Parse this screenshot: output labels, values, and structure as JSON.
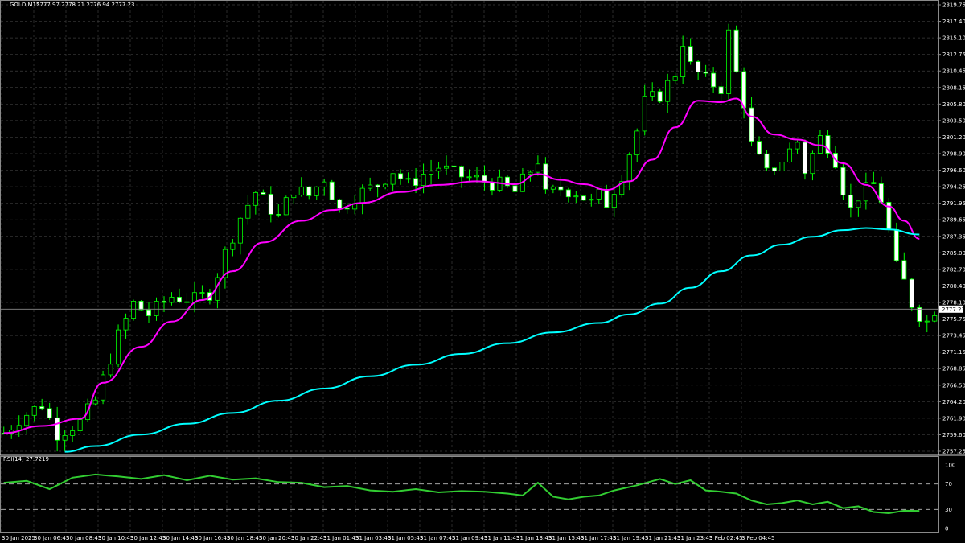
{
  "header": {
    "symbol": "GOLD,M15",
    "ohlc": "2777.97 2778.21 2776.94 2777.23"
  },
  "rsi": {
    "label": "RSI(14) 27.7219",
    "levels": [
      70,
      30
    ],
    "scale_labels": [
      "100",
      "70",
      "30",
      "0"
    ]
  },
  "colors": {
    "background": "#000000",
    "grid": "#3c3c3c",
    "candle_up": "#000000",
    "candle_down": "#ffffff",
    "candle_border": "#00ff00",
    "ma_fast": "#ff00ff",
    "ma_slow": "#00ffff",
    "rsi_line": "#32cd32",
    "price_line": "#8a8a8a"
  },
  "chart_data": {
    "type": "candlestick",
    "symbol": "GOLD",
    "timeframe": "M15",
    "ylim": [
      2757.25,
      2819.75
    ],
    "y_ticks": [
      "2819.75",
      "2817.40",
      "2815.10",
      "2812.75",
      "2810.45",
      "2808.15",
      "2805.80",
      "2803.50",
      "2801.20",
      "2798.90",
      "2796.60",
      "2794.25",
      "2791.95",
      "2789.65",
      "2787.35",
      "2785.00",
      "2782.70",
      "2780.40",
      "2778.10",
      "2775.75",
      "2773.45",
      "2771.15",
      "2768.85",
      "2766.50",
      "2764.20",
      "2761.90",
      "2759.60",
      "2757.25"
    ],
    "current_price": "2777.23",
    "x_ticks": [
      "30 Jan 2025",
      "30 Jan 06:45",
      "30 Jan 08:45",
      "30 Jan 10:45",
      "30 Jan 12:45",
      "30 Jan 14:45",
      "30 Jan 16:45",
      "30 Jan 18:45",
      "30 Jan 20:45",
      "30 Jan 22:45",
      "31 Jan 01:45",
      "31 Jan 03:45",
      "31 Jan 05:45",
      "31 Jan 07:45",
      "31 Jan 09:45",
      "31 Jan 11:45",
      "31 Jan 13:45",
      "31 Jan 15:45",
      "31 Jan 17:45",
      "31 Jan 19:45",
      "31 Jan 21:45",
      "31 Jan 23:45",
      "3 Feb 02:45",
      "3 Feb 04:45"
    ],
    "close_path": [
      [
        0,
        2760.0
      ],
      [
        2,
        2762.0
      ],
      [
        5,
        2764.0
      ],
      [
        7,
        2760.0
      ],
      [
        10,
        2761.5
      ],
      [
        12,
        2764.5
      ],
      [
        15,
        2773.5
      ],
      [
        17,
        2778.0
      ],
      [
        19,
        2776.5
      ],
      [
        22,
        2779.0
      ],
      [
        25,
        2778.5
      ],
      [
        27,
        2779.5
      ],
      [
        29,
        2785.0
      ],
      [
        31,
        2790.0
      ],
      [
        33,
        2793.5
      ],
      [
        36,
        2790.0
      ],
      [
        38,
        2794.0
      ],
      [
        40,
        2793.0
      ],
      [
        42,
        2795.5
      ],
      [
        44,
        2791.0
      ],
      [
        46,
        2793.0
      ],
      [
        49,
        2794.5
      ],
      [
        51,
        2796.5
      ],
      [
        53,
        2794.5
      ],
      [
        55,
        2796.0
      ],
      [
        57,
        2797.0
      ],
      [
        59,
        2796.0
      ],
      [
        61,
        2795.5
      ],
      [
        63,
        2795.0
      ],
      [
        65,
        2794.5
      ],
      [
        67,
        2793.5
      ],
      [
        68,
        2795.0
      ],
      [
        70,
        2798.0
      ],
      [
        71,
        2793.0
      ],
      [
        73,
        2794.0
      ],
      [
        75,
        2793.5
      ],
      [
        77,
        2792.0
      ],
      [
        78,
        2793.0
      ],
      [
        79,
        2792.0
      ],
      [
        81,
        2796.0
      ],
      [
        83,
        2802.0
      ],
      [
        84,
        2806.0
      ],
      [
        86,
        2807.0
      ],
      [
        88,
        2810.0
      ],
      [
        89,
        2814.5
      ],
      [
        90,
        2811.0
      ],
      [
        92,
        2809.0
      ],
      [
        94,
        2808.0
      ],
      [
        95,
        2815.5
      ],
      [
        96,
        2810.0
      ],
      [
        97,
        2806.0
      ],
      [
        98,
        2800.0
      ],
      [
        100,
        2796.0
      ],
      [
        102,
        2798.0
      ],
      [
        104,
        2800.5
      ],
      [
        105,
        2796.5
      ],
      [
        107,
        2801.0
      ],
      [
        108,
        2800.0
      ],
      [
        109,
        2798.0
      ],
      [
        110,
        2794.0
      ],
      [
        111,
        2791.0
      ],
      [
        112,
        2793.0
      ],
      [
        114,
        2794.5
      ],
      [
        115,
        2792.5
      ],
      [
        116,
        2788.0
      ],
      [
        117,
        2783.0
      ],
      [
        118,
        2781.0
      ],
      [
        119,
        2778.0
      ],
      [
        120,
        2776.5
      ],
      [
        121,
        2775.5
      ],
      [
        122,
        2777.23
      ]
    ],
    "series": [
      {
        "name": "",
        "color": "#ff00ff",
        "points": [
          [
            0,
            2760.0
          ],
          [
            5,
            2761.0
          ],
          [
            10,
            2762.0
          ],
          [
            13,
            2767.0
          ],
          [
            18,
            2772.0
          ],
          [
            22,
            2775.5
          ],
          [
            26,
            2778.5
          ],
          [
            30,
            2782.5
          ],
          [
            34,
            2786.5
          ],
          [
            39,
            2789.5
          ],
          [
            43,
            2791.0
          ],
          [
            47,
            2792.0
          ],
          [
            52,
            2793.5
          ],
          [
            57,
            2794.5
          ],
          [
            62,
            2795.0
          ],
          [
            67,
            2794.6
          ],
          [
            70,
            2796.0
          ],
          [
            73,
            2795.2
          ],
          [
            76,
            2794.6
          ],
          [
            79,
            2793.8
          ],
          [
            82,
            2795.0
          ],
          [
            85,
            2798.0
          ],
          [
            88,
            2802.5
          ],
          [
            91,
            2806.2
          ],
          [
            94,
            2806.0
          ],
          [
            96,
            2806.5
          ],
          [
            98,
            2804.0
          ],
          [
            101,
            2801.5
          ],
          [
            104,
            2800.8
          ],
          [
            107,
            2800.0
          ],
          [
            110,
            2797.5
          ],
          [
            113,
            2794.5
          ],
          [
            116,
            2791.5
          ],
          [
            118,
            2789.5
          ],
          [
            120,
            2787.0
          ]
        ]
      },
      {
        "name": "",
        "color": "#00ffff",
        "points": [
          [
            8,
            2757.4
          ],
          [
            12,
            2758.2
          ],
          [
            18,
            2759.8
          ],
          [
            24,
            2761.3
          ],
          [
            30,
            2762.8
          ],
          [
            36,
            2764.5
          ],
          [
            42,
            2766.2
          ],
          [
            48,
            2767.9
          ],
          [
            54,
            2769.5
          ],
          [
            60,
            2771.0
          ],
          [
            66,
            2772.5
          ],
          [
            72,
            2774.0
          ],
          [
            78,
            2775.3
          ],
          [
            82,
            2776.5
          ],
          [
            86,
            2778.0
          ],
          [
            90,
            2780.2
          ],
          [
            94,
            2782.5
          ],
          [
            98,
            2784.7
          ],
          [
            102,
            2786.2
          ],
          [
            106,
            2787.3
          ],
          [
            110,
            2788.2
          ],
          [
            113,
            2788.5
          ],
          [
            116,
            2788.3
          ],
          [
            120,
            2787.6
          ]
        ]
      },
      {
        "name": "",
        "color": "#32cd32",
        "panel": "rsi",
        "ylim": [
          0,
          100
        ],
        "points": [
          [
            0,
            72
          ],
          [
            3,
            75
          ],
          [
            6,
            62
          ],
          [
            9,
            80
          ],
          [
            12,
            85
          ],
          [
            15,
            82
          ],
          [
            18,
            78
          ],
          [
            21,
            84
          ],
          [
            24,
            76
          ],
          [
            27,
            83
          ],
          [
            30,
            77
          ],
          [
            33,
            79
          ],
          [
            36,
            73
          ],
          [
            39,
            72
          ],
          [
            42,
            65
          ],
          [
            45,
            67
          ],
          [
            48,
            60
          ],
          [
            51,
            58
          ],
          [
            54,
            62
          ],
          [
            57,
            57
          ],
          [
            60,
            59
          ],
          [
            63,
            58
          ],
          [
            66,
            55
          ],
          [
            68,
            52
          ],
          [
            70,
            72
          ],
          [
            72,
            50
          ],
          [
            74,
            46
          ],
          [
            76,
            50
          ],
          [
            78,
            52
          ],
          [
            80,
            60
          ],
          [
            83,
            68
          ],
          [
            86,
            78
          ],
          [
            88,
            70
          ],
          [
            90,
            76
          ],
          [
            92,
            60
          ],
          [
            94,
            58
          ],
          [
            96,
            55
          ],
          [
            98,
            44
          ],
          [
            100,
            38
          ],
          [
            102,
            40
          ],
          [
            104,
            44
          ],
          [
            106,
            38
          ],
          [
            108,
            42
          ],
          [
            110,
            32
          ],
          [
            112,
            35
          ],
          [
            114,
            26
          ],
          [
            116,
            24
          ],
          [
            118,
            28
          ],
          [
            120,
            27.7
          ]
        ]
      }
    ]
  }
}
